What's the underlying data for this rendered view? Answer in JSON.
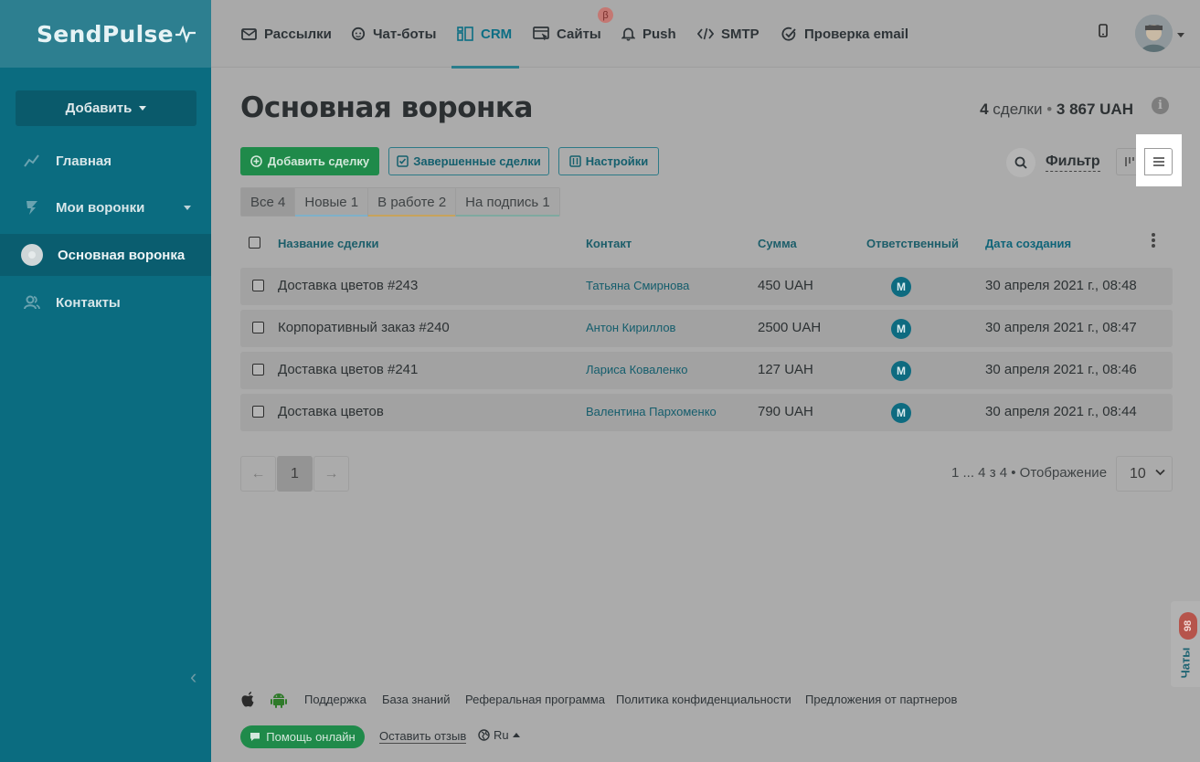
{
  "sidebar": {
    "logo": "SendPulse",
    "add_button": "Добавить",
    "items": [
      {
        "label": "Главная"
      },
      {
        "label": "Мои воронки"
      },
      {
        "label": "Основная воронка"
      },
      {
        "label": "Контакты"
      }
    ]
  },
  "topnav": {
    "tabs": [
      {
        "label": "Рассылки",
        "icon": "mail-icon"
      },
      {
        "label": "Чат-боты",
        "icon": "chat-bot-icon"
      },
      {
        "label": "CRM",
        "icon": "crm-icon"
      },
      {
        "label": "Сайты",
        "icon": "sites-icon"
      },
      {
        "label": "Push",
        "icon": "bell-icon"
      },
      {
        "label": "SMTP",
        "icon": "code-icon"
      },
      {
        "label": "Проверка email",
        "icon": "check-circle-icon"
      }
    ],
    "beta_badge": "β",
    "active_tab": "CRM"
  },
  "main": {
    "title": "Основная воронка",
    "summary_count": "4",
    "summary_count_label": "сделки",
    "summary_sep": "•",
    "summary_amount": "3 867 UAH",
    "buttons": {
      "add_deal": "Добавить сделку",
      "completed": "Завершенные сделки",
      "settings": "Настройки"
    },
    "filter_label": "Фильтр",
    "stages": [
      {
        "label": "Все 4",
        "color": ""
      },
      {
        "label": "Новые 1",
        "color": "#7fb0c9"
      },
      {
        "label": "В работе 2",
        "color": "#c7a35c"
      },
      {
        "label": "На подпись 1",
        "color": "#7fa9a0"
      }
    ],
    "table": {
      "columns": [
        "Название сделки",
        "Контакт",
        "Сумма",
        "Ответственный",
        "Дата создания"
      ],
      "rows": [
        {
          "name": "Доставка цветов #243",
          "contact": "Татьяна Смирнова",
          "sum": "450 UAH",
          "resp": "M",
          "date": "30 апреля 2021 г., 08:48"
        },
        {
          "name": "Корпоративный заказ #240",
          "contact": "Антон Кириллов",
          "sum": "2500 UAH",
          "resp": "M",
          "date": "30 апреля 2021 г., 08:47"
        },
        {
          "name": "Доставка цветов #241",
          "contact": "Лариса Коваленко",
          "sum": "127 UAH",
          "resp": "M",
          "date": "30 апреля 2021 г., 08:46"
        },
        {
          "name": "Доставка цветов",
          "contact": "Валентина Пархоменко",
          "sum": "790 UAH",
          "resp": "M",
          "date": "30 апреля 2021 г., 08:44"
        }
      ]
    },
    "pagination": {
      "prev": "←",
      "current": "1",
      "next": "→",
      "info": "1 ... 4 з 4 • Отображение",
      "per_page": "10"
    }
  },
  "footer": {
    "links": [
      "Поддержка",
      "База знаний",
      "Реферальная программа",
      "Политика конфиденциальности",
      "Предложения от партнеров"
    ],
    "help_button": "Помощь онлайн",
    "feedback": "Оставить отзыв",
    "language": "Ru"
  },
  "chat_widget": {
    "label": "Чаты",
    "count": "98"
  },
  "colors": {
    "sidebar": "#0b6c80",
    "accent_green": "#1f8a4a",
    "brand_teal": "#0c6e84"
  }
}
